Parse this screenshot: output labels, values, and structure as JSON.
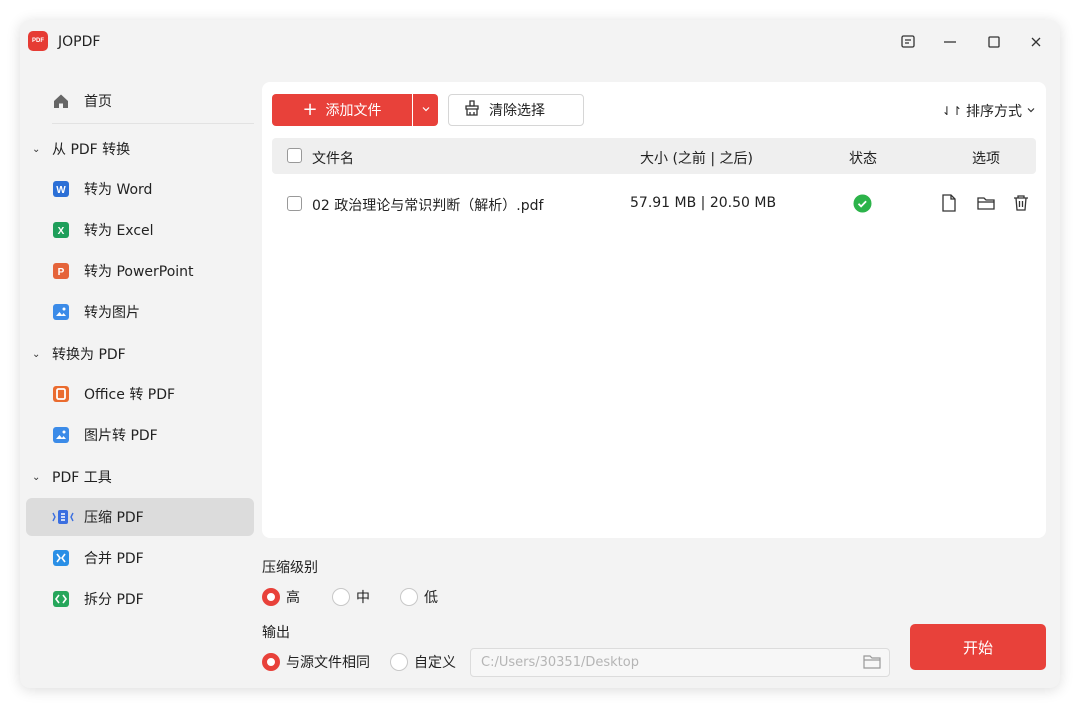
{
  "app": {
    "title": "JOPDF",
    "logo_text": "PDF"
  },
  "sidebar": {
    "home": "首页",
    "groups": [
      {
        "label": "从 PDF 转换",
        "items": [
          "转为 Word",
          "转为 Excel",
          "转为 PowerPoint",
          "转为图片"
        ]
      },
      {
        "label": "转换为 PDF",
        "items": [
          "Office 转 PDF",
          "图片转 PDF"
        ]
      },
      {
        "label": "PDF 工具",
        "items": [
          "压缩 PDF",
          "合并 PDF",
          "拆分 PDF"
        ]
      }
    ],
    "active": "压缩 PDF"
  },
  "toolbar": {
    "add_label": "添加文件",
    "clear_label": "清除选择",
    "sort_label": "排序方式"
  },
  "table": {
    "headers": {
      "name": "文件名",
      "size": "大小 (之前 | 之后)",
      "status": "状态",
      "options": "选项"
    },
    "rows": [
      {
        "name": "02 政治理论与常识判断（解析）.pdf",
        "size": "57.91 MB | 20.50 MB",
        "status": "done"
      }
    ]
  },
  "compression": {
    "label": "压缩级别",
    "options": [
      "高",
      "中",
      "低"
    ],
    "selected": "高"
  },
  "output": {
    "label": "输出",
    "options": [
      "与源文件相同",
      "自定义"
    ],
    "selected": "与源文件相同",
    "path_placeholder": "C:/Users/30351/Desktop"
  },
  "start_label": "开始",
  "colors": {
    "accent": "#e8413a",
    "success": "#2cb34a"
  }
}
